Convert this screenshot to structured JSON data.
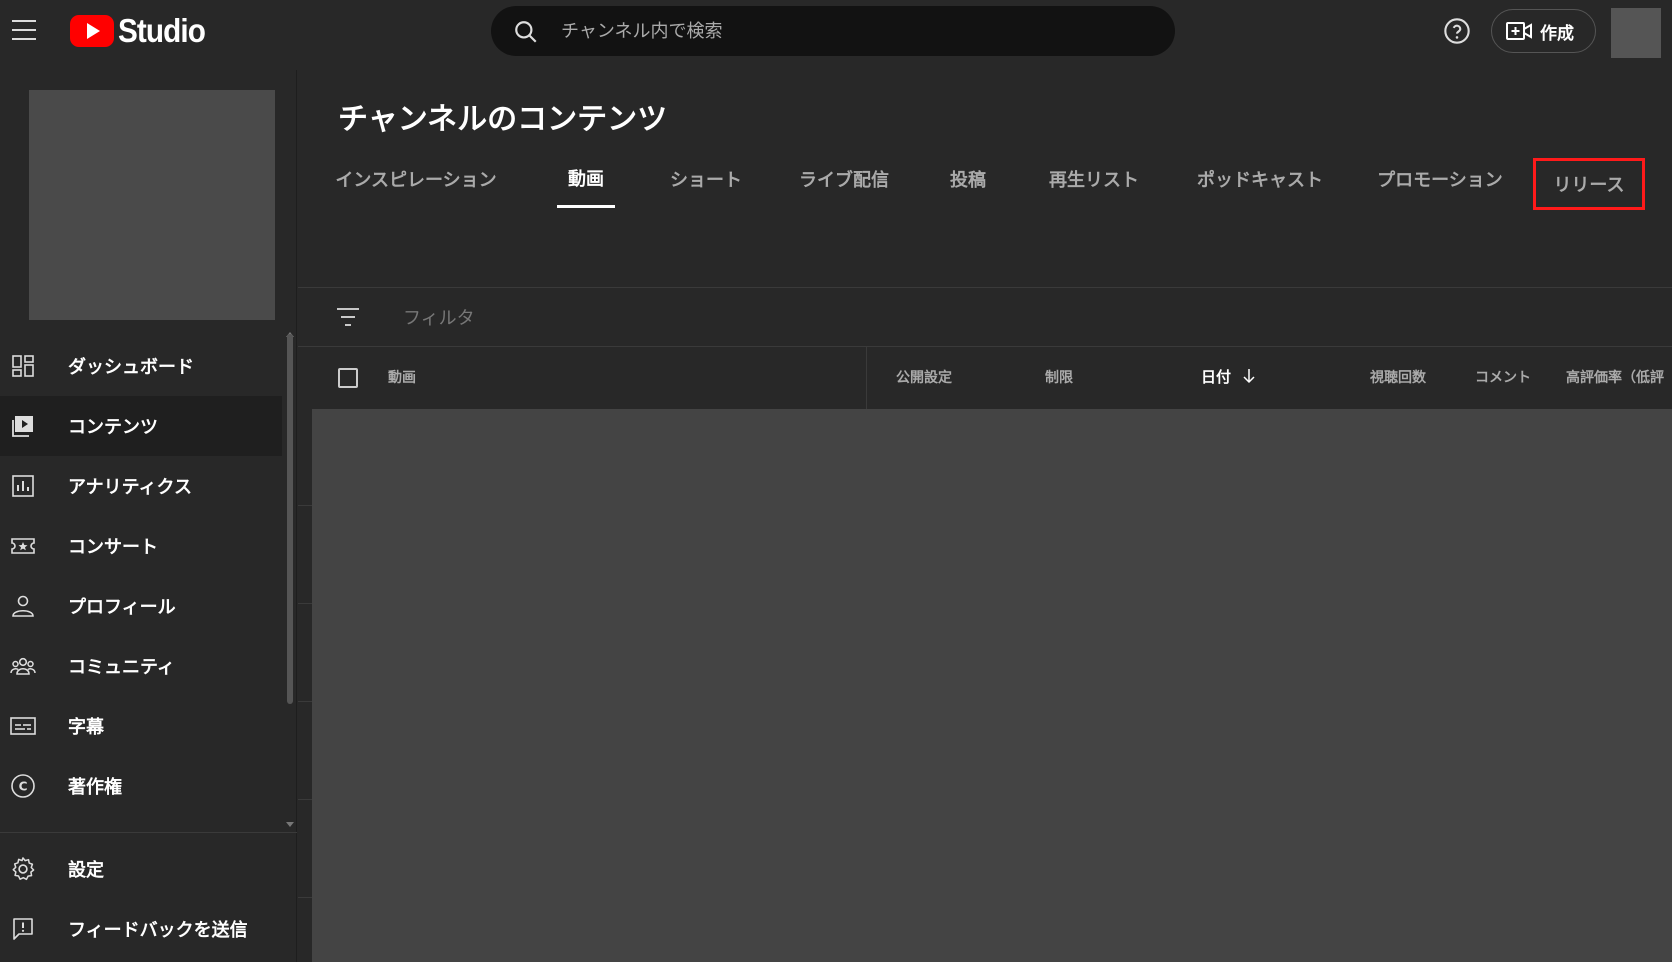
{
  "app": {
    "logo_text": "Studio",
    "search_placeholder": "チャンネル内で検索",
    "create_label": "作成"
  },
  "sidebar": {
    "items": [
      {
        "label": "ダッシュボード",
        "icon": "dashboard-icon"
      },
      {
        "label": "コンテンツ",
        "icon": "content-icon",
        "active": true
      },
      {
        "label": "アナリティクス",
        "icon": "analytics-icon"
      },
      {
        "label": "コンサート",
        "icon": "ticket-icon"
      },
      {
        "label": "プロフィール",
        "icon": "person-icon"
      },
      {
        "label": "コミュニティ",
        "icon": "community-icon"
      },
      {
        "label": "字幕",
        "icon": "subtitles-icon"
      },
      {
        "label": "著作権",
        "icon": "copyright-icon"
      }
    ],
    "bottom_items": [
      {
        "label": "設定",
        "icon": "gear-icon"
      },
      {
        "label": "フィードバックを送信",
        "icon": "feedback-icon"
      }
    ]
  },
  "main": {
    "title": "チャンネルのコンテンツ",
    "tabs": [
      {
        "label": "インスピレーション"
      },
      {
        "label": "動画",
        "active": true
      },
      {
        "label": "ショート"
      },
      {
        "label": "ライブ配信"
      },
      {
        "label": "投稿"
      },
      {
        "label": "再生リスト"
      },
      {
        "label": "ポッドキャスト"
      },
      {
        "label": "プロモーション"
      },
      {
        "label": "リリース",
        "highlighted": true
      }
    ],
    "filter_label": "フィルタ",
    "columns": {
      "video": "動画",
      "visibility": "公開設定",
      "restrictions": "制限",
      "date": "日付",
      "views": "視聴回数",
      "comments": "コメント",
      "likes": "高評価率（低評"
    }
  },
  "colors": {
    "highlight": "#ff1a1a",
    "brand": "#ff0000"
  }
}
